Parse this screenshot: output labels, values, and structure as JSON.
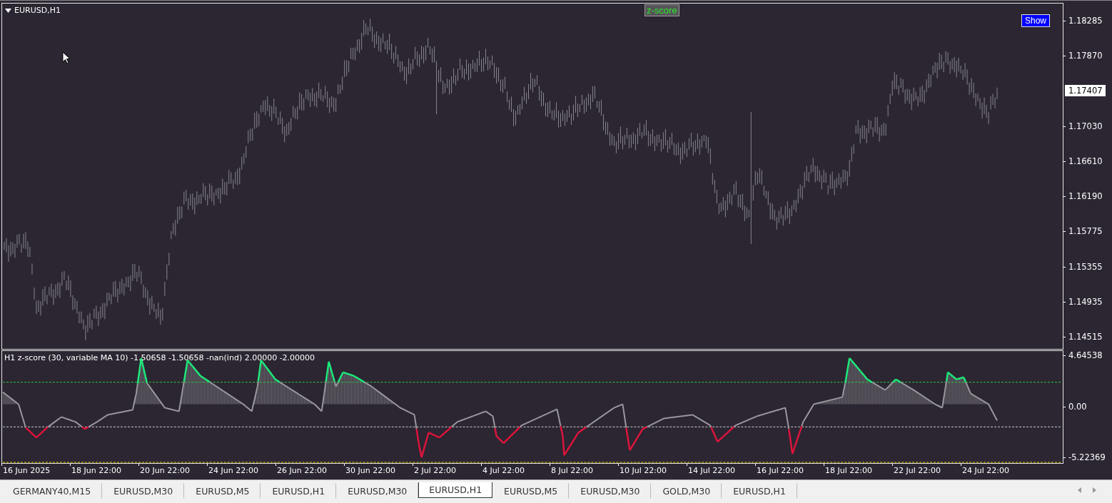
{
  "chart": {
    "symbol_title": "EURUSD,H1",
    "indicator_badge": "z-score",
    "show_button": "Show",
    "price_axis": [
      "1.18285",
      "1.17870",
      "1.17030",
      "1.16610",
      "1.16190",
      "1.15775",
      "1.15355",
      "1.14935",
      "1.14515"
    ],
    "current_price": "1.17407"
  },
  "indicator": {
    "label": "H1 z-score (30, variable MA 10) -1.50658 -1.50658 -nan(ind) 2.00000 -2.00000",
    "axis": [
      "4.64538",
      "0.00",
      "-5.22369"
    ]
  },
  "time_axis": [
    "16 Jun 2025",
    "18 Jun 22:00",
    "20 Jun 22:00",
    "24 Jun 22:00",
    "26 Jun 22:00",
    "30 Jun 22:00",
    "2 Jul 22:00",
    "4 Jul 22:00",
    "8 Jul 22:00",
    "10 Jul 22:00",
    "14 Jul 22:00",
    "16 Jul 22:00",
    "18 Jul 22:00",
    "22 Jul 22:00",
    "24 Jul 22:00"
  ],
  "tabs": [
    {
      "label": "GERMANY40,M15",
      "selected": false
    },
    {
      "label": "EURUSD,M30",
      "selected": false
    },
    {
      "label": "EURUSD,M5",
      "selected": false
    },
    {
      "label": "EURUSD,H1",
      "selected": false
    },
    {
      "label": "EURUSD,M30",
      "selected": false
    },
    {
      "label": "EURUSD,H1",
      "selected": true
    },
    {
      "label": "EURUSD,M5",
      "selected": false
    },
    {
      "label": "EURUSD,M30",
      "selected": false
    },
    {
      "label": "GOLD,M30",
      "selected": false
    },
    {
      "label": "EURUSD,H1",
      "selected": false
    }
  ]
}
